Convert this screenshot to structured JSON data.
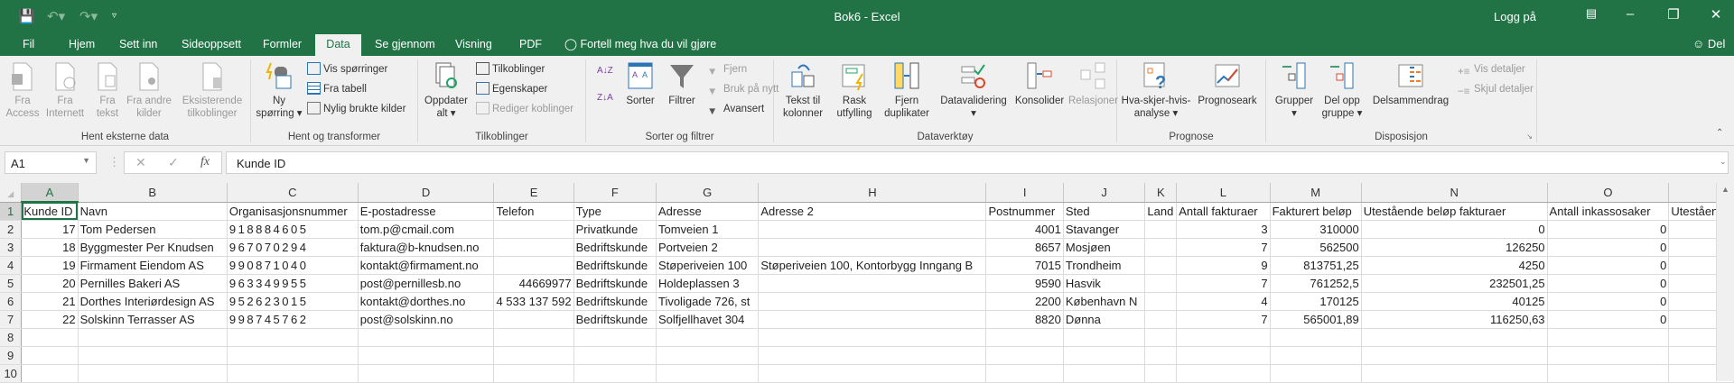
{
  "window": {
    "title": "Bok6  -  Excel",
    "login": "Logg på",
    "share": "Del"
  },
  "tabs": [
    {
      "label": "Fil"
    },
    {
      "label": "Hjem"
    },
    {
      "label": "Sett inn"
    },
    {
      "label": "Sideoppsett"
    },
    {
      "label": "Formler"
    },
    {
      "label": "Data",
      "active": true
    },
    {
      "label": "Se gjennom"
    },
    {
      "label": "Visning"
    },
    {
      "label": "PDF"
    }
  ],
  "tell_me": "Fortell meg hva du vil gjøre",
  "ribbon": {
    "hent_eksterne": {
      "label": "Hent eksterne data",
      "items": [
        "Fra Access",
        "Fra Internett",
        "Fra tekst",
        "Fra andre kilder",
        "Eksisterende tilkoblinger"
      ]
    },
    "hent_transformer": {
      "label": "Hent og transformer",
      "ny": "Ny spørring",
      "vis": "Vis spørringer",
      "fra_tabell": "Fra tabell",
      "nylig": "Nylig brukte kilder"
    },
    "tilkoblinger": {
      "label": "Tilkoblinger",
      "oppdater": "Oppdater alt",
      "tilkoblinger": "Tilkoblinger",
      "egenskaper": "Egenskaper",
      "rediger": "Rediger koblinger"
    },
    "sorter": {
      "label": "Sorter og filtrer",
      "sorter": "Sorter",
      "filtrer": "Filtrer",
      "fjern": "Fjern",
      "bruk": "Bruk på nytt",
      "avansert": "Avansert"
    },
    "dataverktoy": {
      "label": "Dataverktøy",
      "items": [
        "Tekst til kolonner",
        "Rask utfylling",
        "Fjern duplikater",
        "Datavalidering",
        "Konsolider",
        "Relasjoner"
      ]
    },
    "prognose": {
      "label": "Prognose",
      "hva": "Hva-skjer-hvis-analyse",
      "ark": "Prognoseark"
    },
    "disposisjon": {
      "label": "Disposisjon",
      "grupper": "Grupper",
      "del": "Del opp gruppe",
      "delsum": "Delsammendrag",
      "vis": "Vis detaljer",
      "skjul": "Skjul detaljer"
    }
  },
  "formula_bar": {
    "name_box": "A1",
    "formula": "Kunde ID"
  },
  "accent": "#217346",
  "sheet": {
    "columns": [
      "A",
      "B",
      "C",
      "D",
      "E",
      "F",
      "G",
      "H",
      "I",
      "J",
      "K",
      "L",
      "M",
      "N",
      "O",
      ""
    ],
    "rows": [
      [
        "Kunde ID",
        "Navn",
        "Organisasjonsnummer",
        "E-postadresse",
        "Telefon",
        "Type",
        "Adresse",
        "Adresse 2",
        "Postnummer",
        "Sted",
        "Land",
        "Antall fakturaer",
        "Fakturert beløp",
        "Utestående beløp fakturaer",
        "Antall inkassosaker",
        "Utestående"
      ],
      [
        "17",
        "Tom Pedersen",
        "918884605",
        "tom.p@cmail.com",
        "",
        "Privatkunde",
        "Tomveien 1",
        "",
        "4001",
        "Stavanger",
        "",
        "3",
        "310000",
        "0",
        "0",
        ""
      ],
      [
        "18",
        "Byggmester Per Knudsen",
        "967070294",
        "faktura@b-knudsen.no",
        "",
        "Bedriftskunde",
        "Portveien 2",
        "",
        "8657",
        "Mosjøen",
        "",
        "7",
        "562500",
        "126250",
        "0",
        ""
      ],
      [
        "19",
        "Firmament Eiendom AS",
        "990871040",
        "kontakt@firmament.no",
        "",
        "Bedriftskunde",
        "Støperiveien 100",
        "Støperiveien 100, Kontorbygg Inngang B",
        "7015",
        "Trondheim",
        "",
        "9",
        "813751,25",
        "4250",
        "0",
        ""
      ],
      [
        "20",
        "Pernilles Bakeri AS",
        "963349955",
        "post@pernillesb.no",
        "44669977",
        "Bedriftskunde",
        "Holdeplassen 3",
        "",
        "9590",
        "Hasvik",
        "",
        "7",
        "761252,5",
        "232501,25",
        "0",
        ""
      ],
      [
        "21",
        "Dorthes Interiørdesign AS",
        "952623015",
        "kontakt@dorthes.no",
        "4 533 137 592",
        "Bedriftskunde",
        "Tivoligade 726, st",
        "",
        "2200",
        "København N",
        "",
        "4",
        "170125",
        "40125",
        "0",
        ""
      ],
      [
        "22",
        "Solskinn Terrasser AS",
        "998745762",
        "post@solskinn.no",
        "",
        "Bedriftskunde",
        "Solfjellhavet 304",
        "",
        "8820",
        "Dønna",
        "",
        "7",
        "565001,89",
        "116250,63",
        "0",
        ""
      ],
      [
        "",
        "",
        "",
        "",
        "",
        "",
        "",
        "",
        "",
        "",
        "",
        "",
        "",
        "",
        "",
        ""
      ],
      [
        "",
        "",
        "",
        "",
        "",
        "",
        "",
        "",
        "",
        "",
        "",
        "",
        "",
        "",
        "",
        ""
      ],
      [
        "",
        "",
        "",
        "",
        "",
        "",
        "",
        "",
        "",
        "",
        "",
        "",
        "",
        "",
        "",
        ""
      ]
    ]
  }
}
